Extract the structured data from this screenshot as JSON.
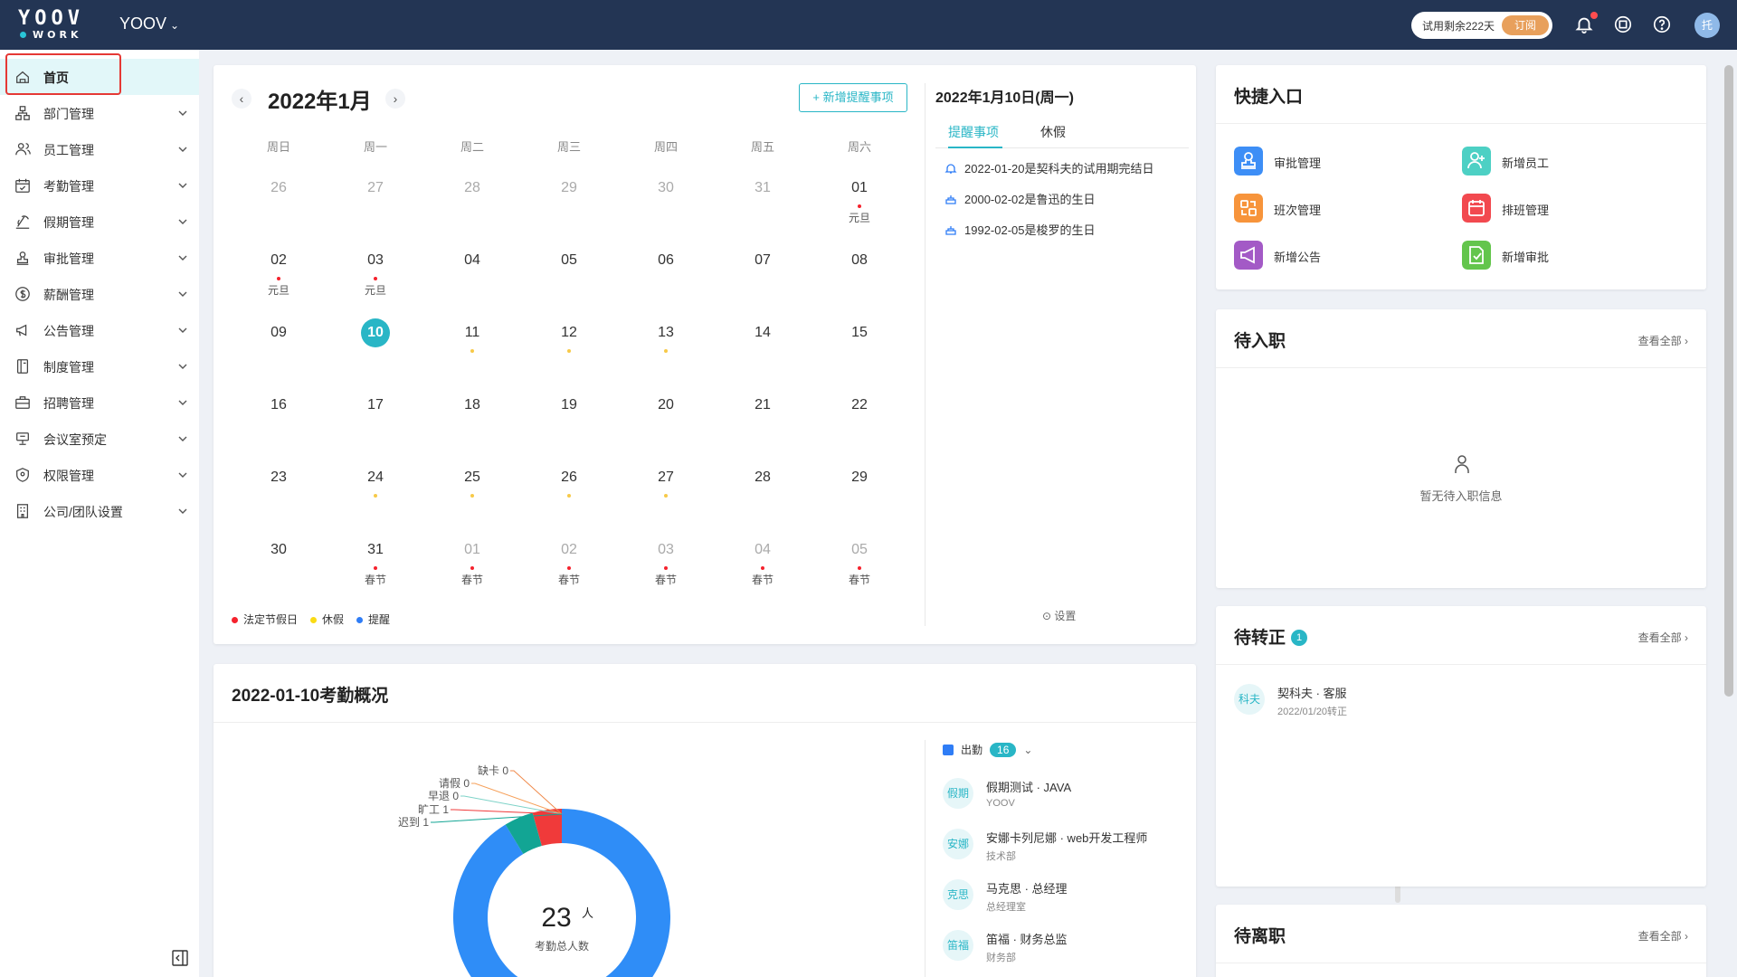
{
  "topbar": {
    "logo_top": "YOOV",
    "logo_bottom": "WORK",
    "company": "YOOV",
    "trial_text": "试用剩余222天",
    "subscribe": "订阅",
    "avatar": "托"
  },
  "sidebar": {
    "items": [
      {
        "label": "首页",
        "icon": "home-icon"
      },
      {
        "label": "部门管理",
        "icon": "department-icon"
      },
      {
        "label": "员工管理",
        "icon": "users-icon"
      },
      {
        "label": "考勤管理",
        "icon": "calendar-check-icon"
      },
      {
        "label": "假期管理",
        "icon": "vacation-icon"
      },
      {
        "label": "审批管理",
        "icon": "stamp-icon"
      },
      {
        "label": "薪酬管理",
        "icon": "dollar-icon"
      },
      {
        "label": "公告管理",
        "icon": "megaphone-icon"
      },
      {
        "label": "制度管理",
        "icon": "book-icon"
      },
      {
        "label": "招聘管理",
        "icon": "briefcase-icon"
      },
      {
        "label": "会议室预定",
        "icon": "meeting-icon"
      },
      {
        "label": "权限管理",
        "icon": "shield-icon"
      },
      {
        "label": "公司/团队设置",
        "icon": "building-icon"
      }
    ]
  },
  "calendar": {
    "month_title": "2022年1月",
    "add_button": "+ 新增提醒事项",
    "weekdays": [
      "周日",
      "周一",
      "周二",
      "周三",
      "周四",
      "周五",
      "周六"
    ],
    "weeks": [
      [
        {
          "n": "26",
          "o": true
        },
        {
          "n": "27",
          "o": true
        },
        {
          "n": "28",
          "o": true
        },
        {
          "n": "29",
          "o": true
        },
        {
          "n": "30",
          "o": true
        },
        {
          "n": "31",
          "o": true
        },
        {
          "n": "01",
          "dot": "red",
          "note": "元旦"
        }
      ],
      [
        {
          "n": "02",
          "dot": "red",
          "note": "元旦"
        },
        {
          "n": "03",
          "dot": "red",
          "note": "元旦"
        },
        {
          "n": "04"
        },
        {
          "n": "05"
        },
        {
          "n": "06"
        },
        {
          "n": "07"
        },
        {
          "n": "08"
        }
      ],
      [
        {
          "n": "09"
        },
        {
          "n": "10",
          "today": true
        },
        {
          "n": "11",
          "dot": "yellow"
        },
        {
          "n": "12",
          "dot": "yellow"
        },
        {
          "n": "13",
          "dot": "yellow"
        },
        {
          "n": "14"
        },
        {
          "n": "15"
        }
      ],
      [
        {
          "n": "16"
        },
        {
          "n": "17"
        },
        {
          "n": "18"
        },
        {
          "n": "19"
        },
        {
          "n": "20"
        },
        {
          "n": "21"
        },
        {
          "n": "22"
        }
      ],
      [
        {
          "n": "23"
        },
        {
          "n": "24",
          "dot": "yellow"
        },
        {
          "n": "25",
          "dot": "yellow"
        },
        {
          "n": "26",
          "dot": "yellow"
        },
        {
          "n": "27",
          "dot": "yellow"
        },
        {
          "n": "28"
        },
        {
          "n": "29"
        }
      ],
      [
        {
          "n": "30"
        },
        {
          "n": "31",
          "dot": "red",
          "note": "春节"
        },
        {
          "n": "01",
          "o": true,
          "dot": "red",
          "note": "春节"
        },
        {
          "n": "02",
          "o": true,
          "dot": "red",
          "note": "春节"
        },
        {
          "n": "03",
          "o": true,
          "dot": "red",
          "note": "春节"
        },
        {
          "n": "04",
          "o": true,
          "dot": "red",
          "note": "春节"
        },
        {
          "n": "05",
          "o": true,
          "dot": "red",
          "note": "春节"
        }
      ]
    ],
    "legend": [
      {
        "label": "法定节假日",
        "color": "#f5222d"
      },
      {
        "label": "休假",
        "color": "#fadb14"
      },
      {
        "label": "提醒",
        "color": "#2f7df6"
      }
    ],
    "dot_colors": {
      "red": "#f5222d",
      "yellow": "#f7c948"
    }
  },
  "reminders": {
    "date_title": "2022年1月10日(周一)",
    "tabs": [
      "提醒事项",
      "休假"
    ],
    "items": [
      {
        "text": "2022-01-20是契科夫的试用期完结日",
        "icon": "bell-icon"
      },
      {
        "text": "2000-02-02是鲁迅的生日",
        "icon": "cake-icon"
      },
      {
        "text": "1992-02-05是梭罗的生日",
        "icon": "cake-icon"
      }
    ],
    "settings": "设置"
  },
  "attendance": {
    "title": "2022-01-10考勤概况",
    "filter_label": "出勤",
    "filter_count": "16",
    "total_value": "23",
    "total_unit": "人",
    "total_label": "考勤总人数",
    "people": [
      {
        "avatar": "假期",
        "name": "假期测试 · JAVA",
        "dept": "YOOV"
      },
      {
        "avatar": "安娜",
        "name": "安娜卡列尼娜 · web开发工程师",
        "dept": "技术部"
      },
      {
        "avatar": "克思",
        "name": "马克思 · 总经理",
        "dept": "总经理室"
      },
      {
        "avatar": "笛福",
        "name": "笛福 · 财务总监",
        "dept": "财务部"
      }
    ]
  },
  "chart_data": {
    "type": "pie",
    "title": "",
    "slices": [
      {
        "label": "出勤",
        "value": 21,
        "color": "#2f8df7"
      },
      {
        "label": "迟到",
        "value": 1,
        "color": "#12a594"
      },
      {
        "label": "旷工",
        "value": 1,
        "color": "#f03a3a"
      },
      {
        "label": "早退",
        "value": 0,
        "color": "#7ed3c8"
      },
      {
        "label": "请假",
        "value": 0,
        "color": "#f6a05a"
      },
      {
        "label": "缺卡",
        "value": 0,
        "color": "#f08a4b"
      }
    ],
    "labels": [
      "缺卡 0",
      "请假 0",
      "早退 0",
      "旷工 1",
      "迟到 1"
    ]
  },
  "quick": {
    "title": "快捷入口",
    "items": [
      {
        "label": "审批管理",
        "color": "#3d8ef6",
        "icon": "approval-icon"
      },
      {
        "label": "新增员工",
        "color": "#4dd0c4",
        "icon": "add-user-icon"
      },
      {
        "label": "班次管理",
        "color": "#f7943b",
        "icon": "shift-icon"
      },
      {
        "label": "排班管理",
        "color": "#f2494f",
        "icon": "schedule-icon"
      },
      {
        "label": "新增公告",
        "color": "#a35ac6",
        "icon": "announcement-icon"
      },
      {
        "label": "新增审批",
        "color": "#63c54c",
        "icon": "new-approval-icon"
      }
    ]
  },
  "onboard": {
    "title": "待入职",
    "more": "查看全部 ›",
    "empty": "暂无待入职信息"
  },
  "regular": {
    "title": "待转正",
    "badge": "1",
    "more": "查看全部 ›",
    "person": {
      "avatar": "科夫",
      "name": "契科夫 · 客服",
      "date": "2022/01/20转正"
    }
  },
  "leaving": {
    "title": "待离职",
    "more": "查看全部 ›"
  }
}
